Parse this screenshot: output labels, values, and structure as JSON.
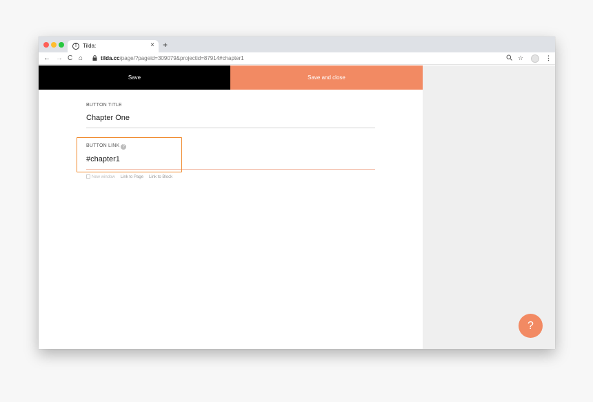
{
  "browser": {
    "tab_title": "Tilda:",
    "tab_close": "×",
    "new_tab": "+",
    "url_host": "tilda.cc",
    "url_path": "/page/?pageid=309079&projectid=87914#chapter1",
    "nav": {
      "back": "←",
      "forward": "→",
      "reload": "C",
      "home": "⌂"
    },
    "icons": {
      "lock": "🔒",
      "zoom": "⊕",
      "star": "☆",
      "menu": "⋮",
      "favicon": "T"
    }
  },
  "editor": {
    "save_label": "Save",
    "save_close_label": "Save and close",
    "button_title_label": "BUTTON TITLE",
    "button_title_value": "Chapter One",
    "button_link_label": "BUTTON LINK",
    "button_link_value": "#chapter1",
    "help_glyph": "?",
    "options": {
      "new_window": "New window",
      "link_to_page": "Link to Page",
      "link_to_block": "Link to Block"
    }
  },
  "help_fab": "?",
  "colors": {
    "accent": "#f28a63",
    "highlight": "#f08a2d",
    "save_bg": "#000000"
  }
}
